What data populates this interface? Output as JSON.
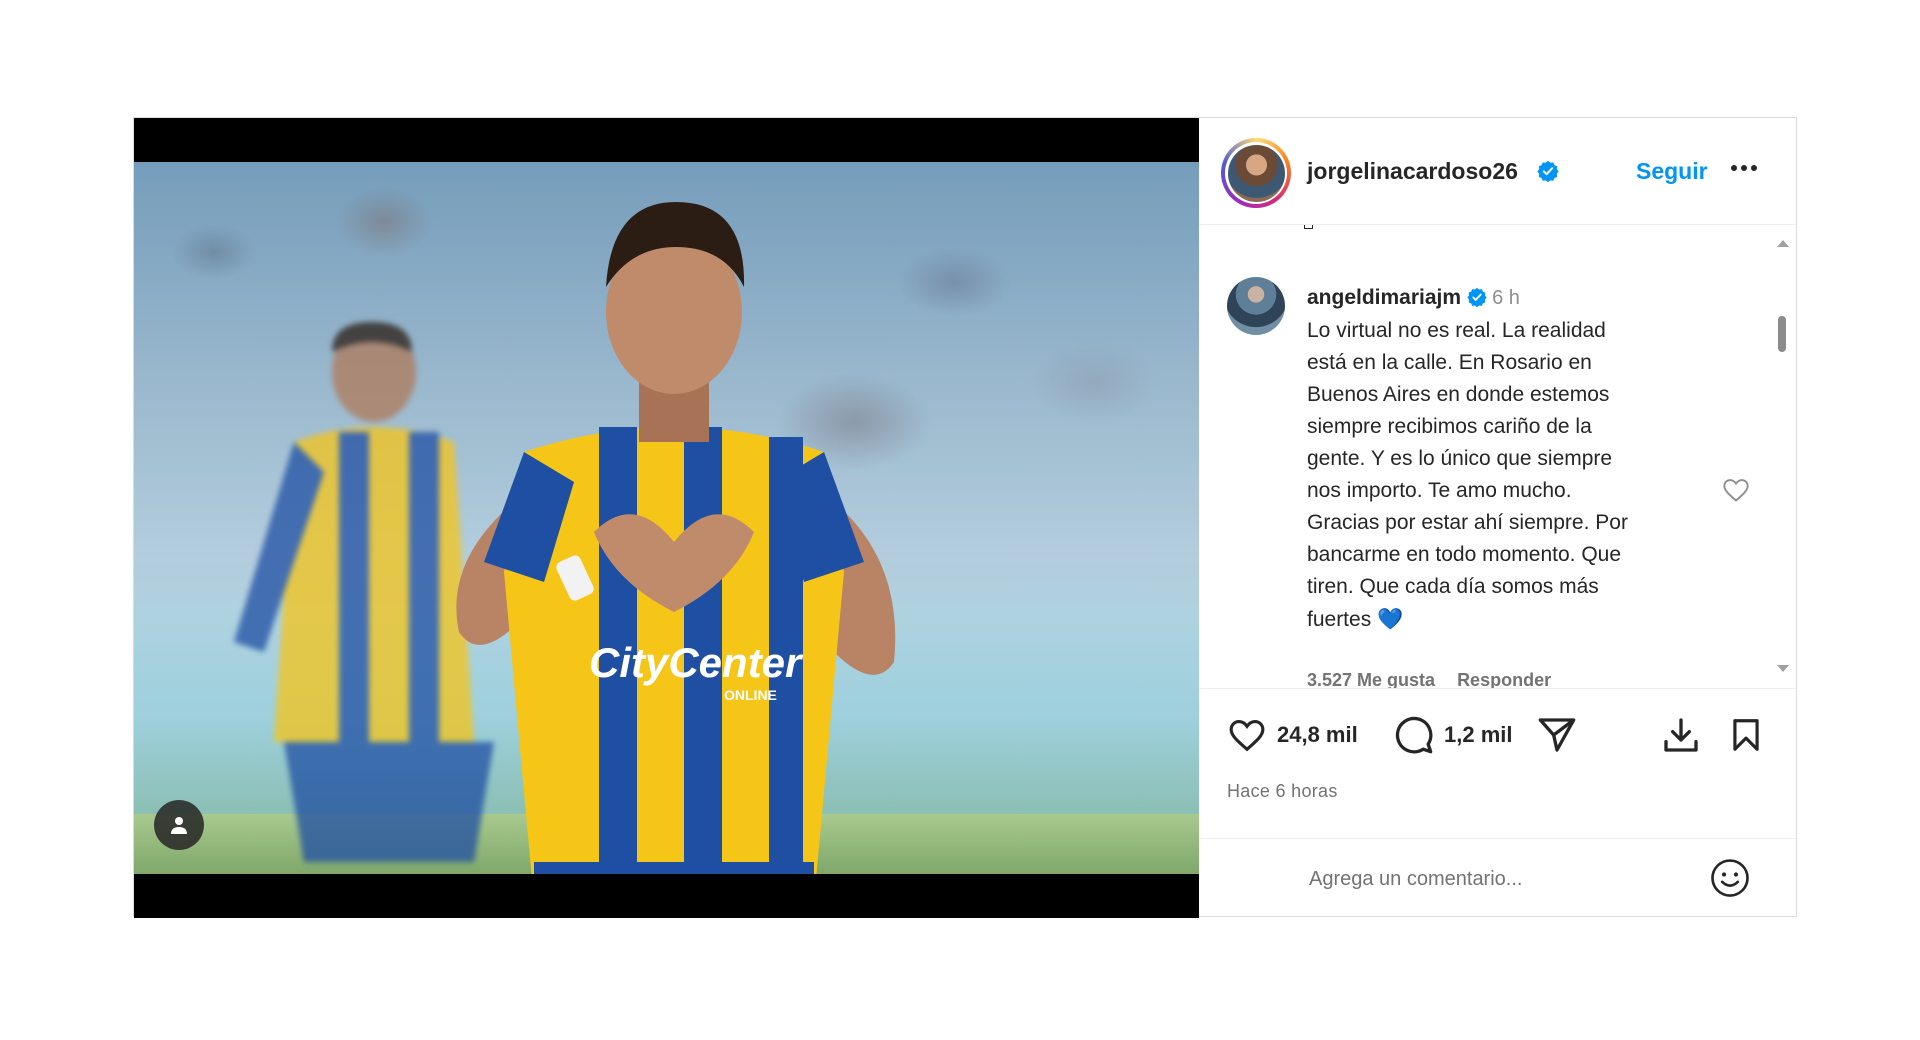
{
  "post": {
    "author": {
      "username": "jorgelinacardoso26",
      "verified": true,
      "avatar_icon": "profile-avatar"
    },
    "follow_label": "Seguir",
    "more_icon": "more-options-icon",
    "media": {
      "user_tag_icon": "person-tag-icon",
      "jersey_sponsor": "CityCenter",
      "jersey_sponsor_sub": "ONLINE"
    },
    "comment": {
      "username": "angeldimariajm",
      "verified": true,
      "time": "6 h",
      "text": "Lo virtual no es real. La realidad\nestá en la calle. En Rosario en\nBuenos Aires en donde estemos\nsiempre recibimos cariño de la\ngente. Y es lo único que siempre\nnos importo. Te amo mucho.\nGracias por estar ahí siempre. Por\nbancarme en todo momento. Que\ntiren. Que cada día somos más\nfuertes",
      "emoji": "💙",
      "likes_label": "3.527 Me gusta",
      "reply_label": "Responder"
    },
    "actions": {
      "likes": "24,8 mil",
      "comments": "1,2 mil"
    },
    "posted_time": "Hace 6 horas",
    "comment_placeholder": "Agrega un comentario...",
    "colors": {
      "accent": "#0095f6",
      "verified": "#0095f6",
      "jersey_yellow": "#f5c518",
      "jersey_blue": "#1f4fa3"
    }
  }
}
